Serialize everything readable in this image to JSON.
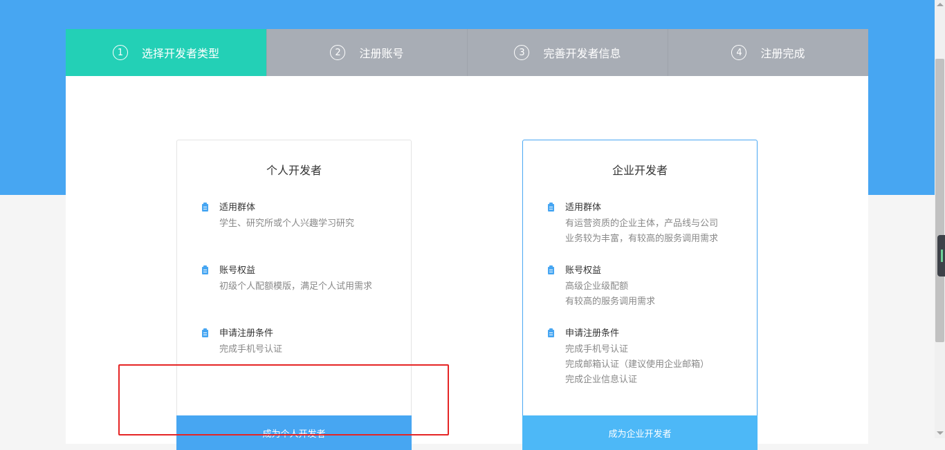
{
  "steps": [
    {
      "num": "1",
      "label": "选择开发者类型"
    },
    {
      "num": "2",
      "label": "注册账号"
    },
    {
      "num": "3",
      "label": "完善开发者信息"
    },
    {
      "num": "4",
      "label": "注册完成"
    }
  ],
  "active_step": 1,
  "cards": {
    "personal": {
      "title": "个人开发者",
      "features": [
        {
          "title": "适用群体",
          "lines": [
            "学生、研究所或个人兴趣学习研究"
          ]
        },
        {
          "title": "账号权益",
          "lines": [
            "初级个人配额模版，满足个人试用需求"
          ]
        },
        {
          "title": "申请注册条件",
          "lines": [
            "完成手机号认证"
          ]
        }
      ],
      "button": "成为个人开发者"
    },
    "enterprise": {
      "title": "企业开发者",
      "features": [
        {
          "title": "适用群体",
          "lines": [
            "有运营资质的企业主体，产品线与公司",
            "业务较为丰富，有较高的服务调用需求"
          ]
        },
        {
          "title": "账号权益",
          "lines": [
            "高级企业级配额",
            "有较高的服务调用需求"
          ]
        },
        {
          "title": "申请注册条件",
          "lines": [
            "完成手机号认证",
            "完成邮箱认证（建议使用企业邮箱）",
            "完成企业信息认证"
          ]
        }
      ],
      "button": "成为企业开发者"
    }
  },
  "icons": {
    "feature_icon": "document-icon"
  },
  "colors": {
    "header_band": "#47a6f2",
    "active_step": "#23d0b6",
    "inactive_step": "#a8adb5",
    "button_personal": "#47a6f2",
    "button_enterprise": "#4db8f7",
    "highlight": "#e52424"
  }
}
